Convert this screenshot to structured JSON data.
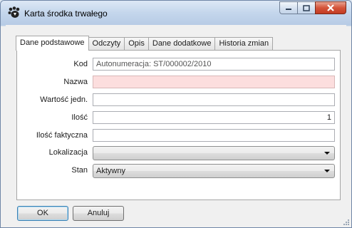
{
  "window": {
    "title": "Karta środka trwałego",
    "buttons": {
      "minimize": "minimize",
      "maximize": "maximize",
      "close": "close"
    }
  },
  "tabs": [
    {
      "label": "Dane podstawowe",
      "active": true
    },
    {
      "label": "Odczyty",
      "active": false
    },
    {
      "label": "Opis",
      "active": false
    },
    {
      "label": "Dane dodatkowe",
      "active": false
    },
    {
      "label": "Historia zmian",
      "active": false
    }
  ],
  "form": {
    "kod": {
      "label": "Kod",
      "value": "Autonumeracja: ST/000002/2010"
    },
    "nazwa": {
      "label": "Nazwa",
      "value": ""
    },
    "wartosc": {
      "label": "Wartość jedn.",
      "value": ""
    },
    "ilosc": {
      "label": "Ilość",
      "value": "1"
    },
    "ilosc_faktyczna": {
      "label": "Ilość faktyczna",
      "value": ""
    },
    "lokalizacja": {
      "label": "Lokalizacja",
      "value": ""
    },
    "stan": {
      "label": "Stan",
      "value": "Aktywny"
    }
  },
  "footer": {
    "ok_label": "OK",
    "cancel_label": "Anuluj"
  },
  "colors": {
    "required_field": "#fcdede",
    "close_button": "#c23b22"
  }
}
